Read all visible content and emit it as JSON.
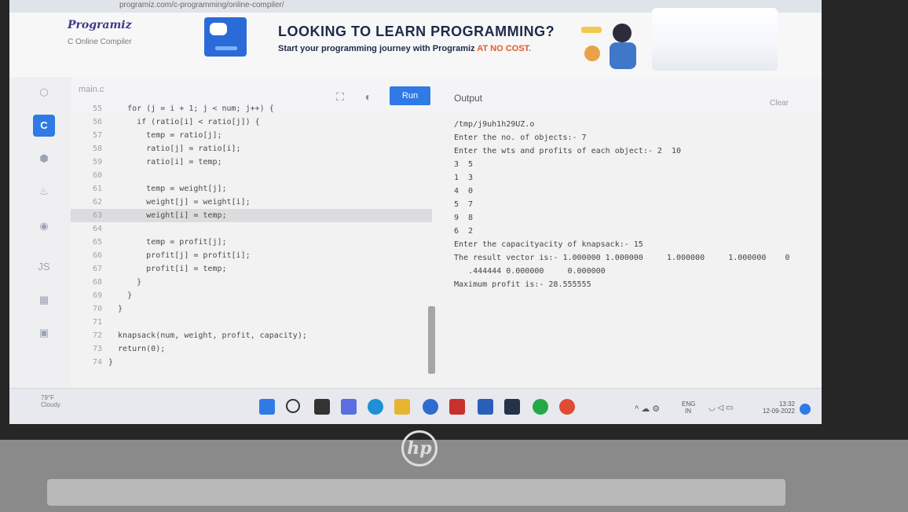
{
  "browser": {
    "url": "programiz.com/c-programming/online-compiler/"
  },
  "header": {
    "brand": "Programiz",
    "brand_sub": "C Online Compiler",
    "ad_title": "LOOKING TO LEARN PROGRAMMING?",
    "ad_sub_prefix": "Start your programming journey with Programiz ",
    "ad_sub_accent": "AT NO COST.",
    "accent_color": "#e45a2a"
  },
  "editor": {
    "file_tab": "main.c",
    "run_label": "Run",
    "lines": [
      {
        "n": "55",
        "t": "    for (j = i + 1; j < num; j++) {"
      },
      {
        "n": "56",
        "t": "      if (ratio[i] < ratio[j]) {"
      },
      {
        "n": "57",
        "t": "        temp = ratio[j];"
      },
      {
        "n": "58",
        "t": "        ratio[j] = ratio[i];"
      },
      {
        "n": "59",
        "t": "        ratio[i] = temp;"
      },
      {
        "n": "60",
        "t": ""
      },
      {
        "n": "61",
        "t": "        temp = weight[j];"
      },
      {
        "n": "62",
        "t": "        weight[j] = weight[i];"
      },
      {
        "n": "63",
        "t": "        weight[i] = temp;"
      },
      {
        "n": "64",
        "t": ""
      },
      {
        "n": "65",
        "t": "        temp = profit[j];"
      },
      {
        "n": "66",
        "t": "        profit[j] = profit[i];"
      },
      {
        "n": "67",
        "t": "        profit[i] = temp;"
      },
      {
        "n": "68",
        "t": "      }"
      },
      {
        "n": "69",
        "t": "    }"
      },
      {
        "n": "70",
        "t": "  }"
      },
      {
        "n": "71",
        "t": ""
      },
      {
        "n": "72",
        "t": "  knapsack(num, weight, profit, capacity);"
      },
      {
        "n": "73",
        "t": "  return(0);"
      },
      {
        "n": "74",
        "t": "}"
      }
    ],
    "highlight_line": "63"
  },
  "output": {
    "label": "Output",
    "clear_label": "Clear",
    "lines": [
      "/tmp/j9uh1h29UZ.o",
      "Enter the no. of objects:- 7",
      "Enter the wts and profits of each object:- 2  10",
      "3  5",
      "1  3",
      "4  0",
      "5  7",
      "9  8",
      "6  2",
      "Enter the capacityacity of knapsack:- 15",
      "The result vector is:- 1.000000 1.000000     1.000000     1.000000    0",
      "   .444444 0.000000     0.000000",
      "Maximum profit is:- 28.555555"
    ]
  },
  "taskbar": {
    "weather_temp": "79°F",
    "weather_desc": "Cloudy",
    "lang1": "ENG",
    "lang2": "IN",
    "time": "13:32",
    "date": "12-09-2022"
  },
  "laptop": {
    "brand": "hp"
  }
}
